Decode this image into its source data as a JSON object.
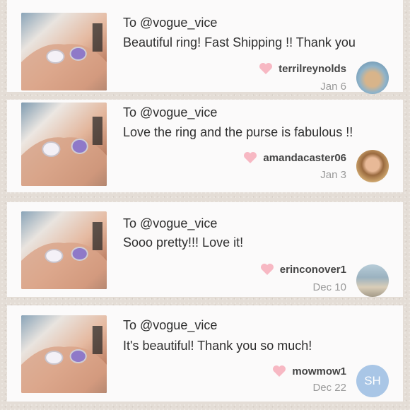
{
  "reviews": [
    {
      "to": "To @vogue_vice",
      "message": "Beautiful ring! Fast Shipping !! Thank you",
      "username": "terrilreynolds",
      "date": "Jan 6",
      "avatar_initials": ""
    },
    {
      "to": "To @vogue_vice",
      "message": "Love the ring and the purse is fabulous !!",
      "username": "amandacaster06",
      "date": "Jan 3",
      "avatar_initials": ""
    },
    {
      "to": "To @vogue_vice",
      "message": "Sooo pretty!!! Love it!",
      "username": "erinconover1",
      "date": "Dec 10",
      "avatar_initials": ""
    },
    {
      "to": "To @vogue_vice",
      "message": "It's beautiful! Thank you so much!",
      "username": "mowmow1",
      "date": "Dec 22",
      "avatar_initials": "SH"
    }
  ],
  "colors": {
    "heart": "#f7b8c3",
    "avatar_placeholder": "#a9c6e6"
  },
  "icons": {
    "like": "heart-icon"
  }
}
